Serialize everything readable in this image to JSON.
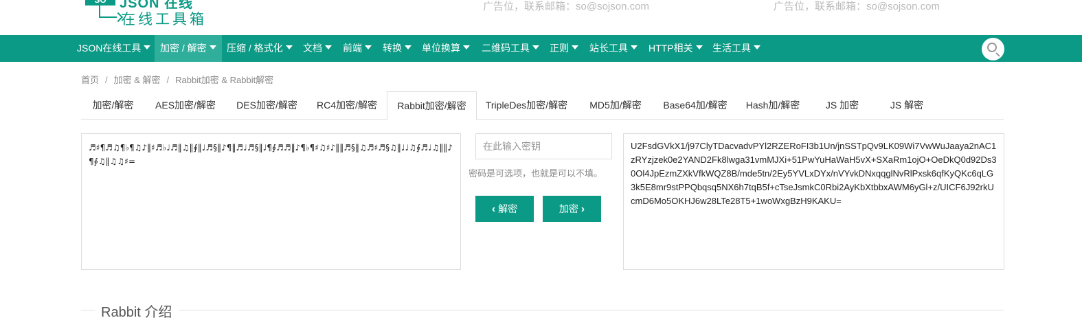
{
  "brand": {
    "logo_badge": "SO",
    "logo_word": "JSON 在线",
    "logo_sub": "在线工具箱",
    "accent_color": "#0a9a85"
  },
  "ads": [
    "广告位，联系邮箱：so@sojson.com",
    "广告位，联系邮箱：so@sojson.com"
  ],
  "nav": {
    "items": [
      {
        "label": "JSON在线工具"
      },
      {
        "label": "加密 / 解密"
      },
      {
        "label": "压缩 / 格式化"
      },
      {
        "label": "文档"
      },
      {
        "label": "前端"
      },
      {
        "label": "转换"
      },
      {
        "label": "单位换算"
      },
      {
        "label": "二维码工具"
      },
      {
        "label": "正则"
      },
      {
        "label": "站长工具"
      },
      {
        "label": "HTTP相关"
      },
      {
        "label": "生活工具"
      }
    ],
    "active": "加密 / 解密",
    "search_icon": "search-icon"
  },
  "breadcrumb": {
    "items": [
      "首页",
      "加密 & 解密",
      "Rabbit加密 & Rabbit解密"
    ],
    "separator": "/"
  },
  "tabs": {
    "items": [
      "加密/解密",
      "AES加密/解密",
      "DES加密/解密",
      "RC4加密/解密",
      "Rabbit加密/解密",
      "TripleDes加密/解密",
      "MD5加/解密",
      "Base64加/解密",
      "Hash加/解密",
      "JS 加密",
      "JS 解密"
    ],
    "active": "Rabbit加密/解密"
  },
  "editor": {
    "plaintext": "♬♯¶♬♫¶♭¶♫♪‖♯♬♭♩♬‖♫‖∮‖♩♬§‖♪¶‖♬♩♬§‖♩¶∮♬♬‖♪¶♭¶♯♫♯♪‖‖♬§‖♫♬♯♬§♫‖♩♩♫∮♬♩♫‖‖♪¶∮♫‖♫♫♯=",
    "key_placeholder": "在此输入密钥",
    "key_value": "",
    "hint": "密码是可选项，也就是可以不填。",
    "decrypt_label": "解密",
    "encrypt_label": "加密",
    "ciphertext": "U2FsdGVkX1/j97ClyTDacvadvPYl2RZERoFI3b1Un/jnSSTpQv9LK09Wi7VwWuJaaya2nAC1zRYzjzek0e2YAND2Fk8lwga31vmMJXi+51PwYuHaWaH5vX+SXaRm1ojO+OeDkQ0d92Ds30Ol4JpEzmZXkVfkWQZ8B/mde5tn/2Ey5YVLxDYx/nVYvkDNxqqglNvRlPxsk6qfKyQKc6qLG3k5E8mr9stPPQbqsq5NX6h7tqB5f+cTseJsmkC0Rbi2AyKbXtbbxAWM6yGl+z/UICF6J92rkUcmD6Mo5OKHJ6w28LTe28T5+1woWxgBzH9KAKU="
  },
  "section": {
    "title": "Rabbit 介绍"
  }
}
